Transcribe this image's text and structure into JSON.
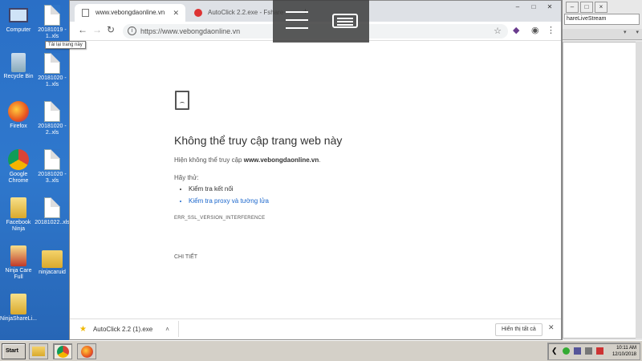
{
  "desktop": {
    "icons": [
      {
        "label": "Computer"
      },
      {
        "label": "20181019 - 1..xls"
      },
      {
        "label": "Recycle Bin"
      },
      {
        "label": "20181020 - 1..xls"
      },
      {
        "label": "Firefox"
      },
      {
        "label": "20181020 - 2..xls"
      },
      {
        "label": "Google Chrome"
      },
      {
        "label": "20181020 - 3..xls"
      },
      {
        "label": "Facebook Ninja"
      },
      {
        "label": "20181022..xls"
      },
      {
        "label": "Ninja Care Full"
      },
      {
        "label": "ninjacaruid"
      },
      {
        "label": "NinjaShareLi..."
      }
    ]
  },
  "browser": {
    "tabs": [
      {
        "title": "www.vebongdaonline.vn",
        "active": true
      },
      {
        "title": "AutoClick 2.2.exe - Fshare",
        "active": false
      }
    ],
    "url": "https://www.vebongdaonline.vn",
    "tooltip": "Tải lại trang này",
    "error": {
      "title": "Không thể truy cập trang web này",
      "desc_prefix": "Hiện không thể truy cập ",
      "domain": "www.vebongdaonline.vn",
      "desc_suffix": ".",
      "try_label": "Hãy thử:",
      "suggestions": [
        "Kiểm tra kết nối",
        "Kiểm tra proxy và tường lửa"
      ],
      "code": "ERR_SSL_VERSION_INTERFERENCE",
      "details_label": "CHI TIẾT"
    },
    "download": {
      "file": "AutoClick 2.2 (1).exe",
      "show_all": "Hiển thị tất cả"
    }
  },
  "right_app": {
    "field_text": "hareLiveStream"
  },
  "taskbar": {
    "start_label": "Start",
    "time": "10:11 AM",
    "date": "12/10/2018"
  }
}
